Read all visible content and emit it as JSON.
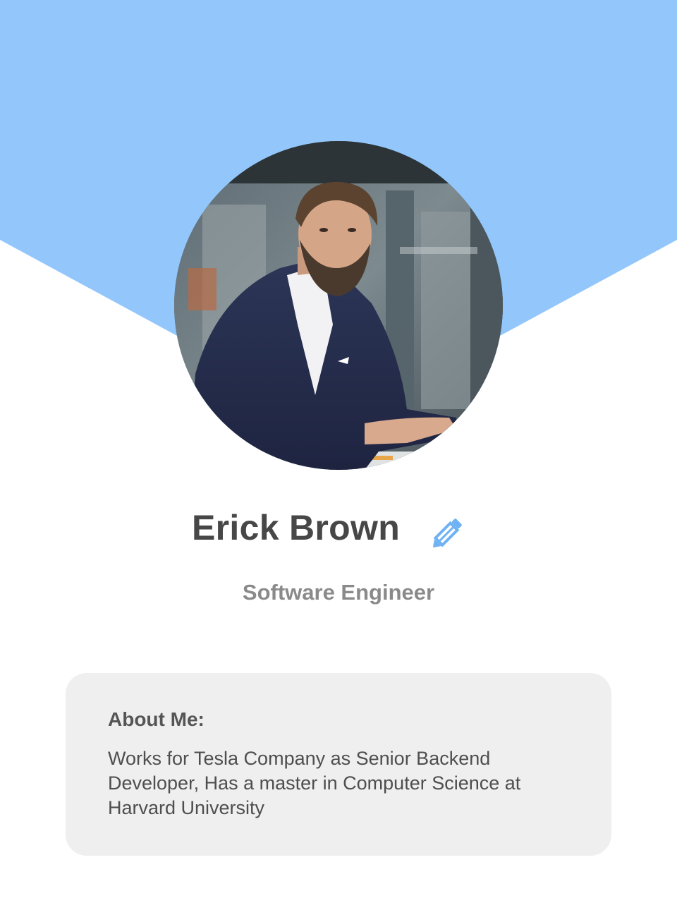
{
  "colors": {
    "header_blue": "#93c7fc",
    "accent_blue": "#6fb2f4",
    "card_bg": "#efefef",
    "name_text": "#474747",
    "subtitle_text": "#8a8a8a"
  },
  "profile": {
    "avatar_icon": "profile-photo",
    "name": "Erick Brown",
    "edit_icon": "pencil-icon",
    "job_title": "Software Engineer"
  },
  "about": {
    "heading": "About Me:",
    "text": "Works for Tesla Company as Senior Backend Developer, Has a master in Computer Science at Harvard University"
  }
}
